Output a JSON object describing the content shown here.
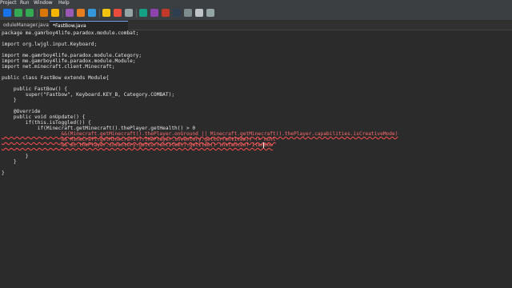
{
  "menubar": {
    "items": [
      "Project",
      "Run",
      "Window",
      "Help"
    ]
  },
  "toolbar": {
    "icons": [
      "run-icon",
      "save-icon",
      "search-icon",
      "settings-icon",
      "undo-icon",
      "redo-icon",
      "back-icon",
      "forward-icon",
      "maximize-icon"
    ]
  },
  "tabs": [
    {
      "label": "oduleManager.java"
    },
    {
      "label": "*FastBow.java"
    }
  ],
  "code": [
    "package me.gamrboy4life.paradox.module.combat;",
    "",
    "import org.lwjgl.input.Keyboard;",
    "",
    "import me.gamrboy4life.paradox.module.Category;",
    "import me.gamrboy4life.paradox.module.Module;",
    "import net.minecraft.client.Minecraft;",
    "",
    "public class FastBow extends Module{",
    "",
    "    public FastBow() {",
    "        super(\"Fastbow\", Keyboard.KEY_B, Category.COMBAT);",
    "    }",
    "",
    "    @Override",
    "    public void onUpdate() {",
    "        if(this.isToggled()) {",
    "            if(Minecraft.getMinecraft().thePlayer.getHealth() > 0",
    "                    &&(Minecraft.getMinecraft().thePlayer.onGround || Minecraft.getMinecraft().thePlayer.capabilities.isCreativeMode)",
    "                    && Minecraft.getMinecraft().thePlayer.inventory.getCurrentItem() != null",
    "                    && mc.thePlayer.inventory.getCurrentItem().getItem() instanceof ItemBow",
    "",
    "        }",
    "    }",
    "",
    "}"
  ]
}
